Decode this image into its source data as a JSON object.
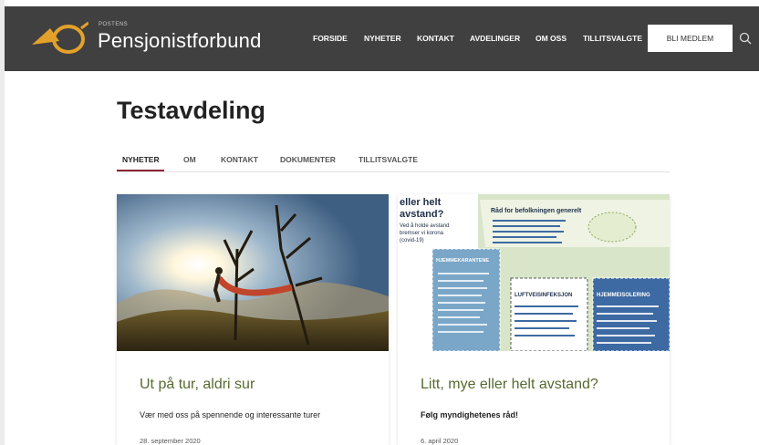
{
  "header": {
    "brand_small": "POSTENS",
    "brand": "Pensjonistforbund",
    "nav": [
      "FORSIDE",
      "NYHETER",
      "KONTAKT",
      "AVDELINGER",
      "OM OSS",
      "TILLITSVALGTE"
    ],
    "join_label": "BLI MEDLEM"
  },
  "page": {
    "title": "Testavdeling",
    "tabs": [
      "NYHETER",
      "OM",
      "KONTAKT",
      "DOKUMENTER",
      "TILLITSVALGTE"
    ],
    "active_tab": "NYHETER"
  },
  "cards": [
    {
      "title": "Ut på tur, aldri sur",
      "text": "Vær med oss på spennende og interessante turer",
      "date": "28. september 2020"
    },
    {
      "title": "Litt, mye eller helt avstand?",
      "text": "Følg myndighetenes råd!",
      "date": "6. april 2020",
      "poster": {
        "heading_line1": "eller helt",
        "heading_line2": "avstand?",
        "intro": [
          "Ved å holde avstand",
          "bremser vi korona",
          "(covid-19)"
        ],
        "advice_title": "Råd for befolkningen generelt",
        "box1": "HJEMMEKARANTENE",
        "box2": "LUFTVEISINFEKSJON",
        "box3": "HJEMMEISOLERING"
      }
    }
  ],
  "colors": {
    "header_bg": "#404040",
    "accent": "#8b2635",
    "logo": "#e2a12a",
    "card_title": "#556b2f"
  }
}
